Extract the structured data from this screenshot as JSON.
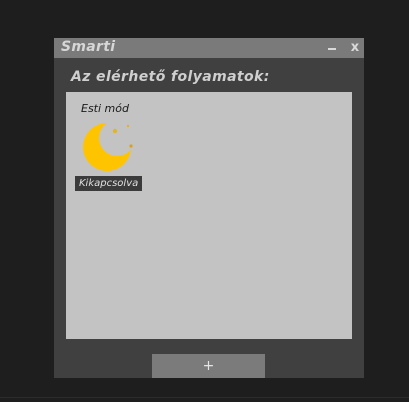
{
  "window": {
    "title": "Smarti",
    "minimize_label": "–",
    "close_label": "x"
  },
  "main": {
    "heading": "Az elérhető folyamatok:",
    "processes": [
      {
        "name": "Esti mód",
        "icon": "moon-icon",
        "status": "Kikapcsolva"
      }
    ],
    "add_button_label": "+"
  },
  "colors": {
    "moon": "#ffc400",
    "stars": "#e0b020"
  }
}
